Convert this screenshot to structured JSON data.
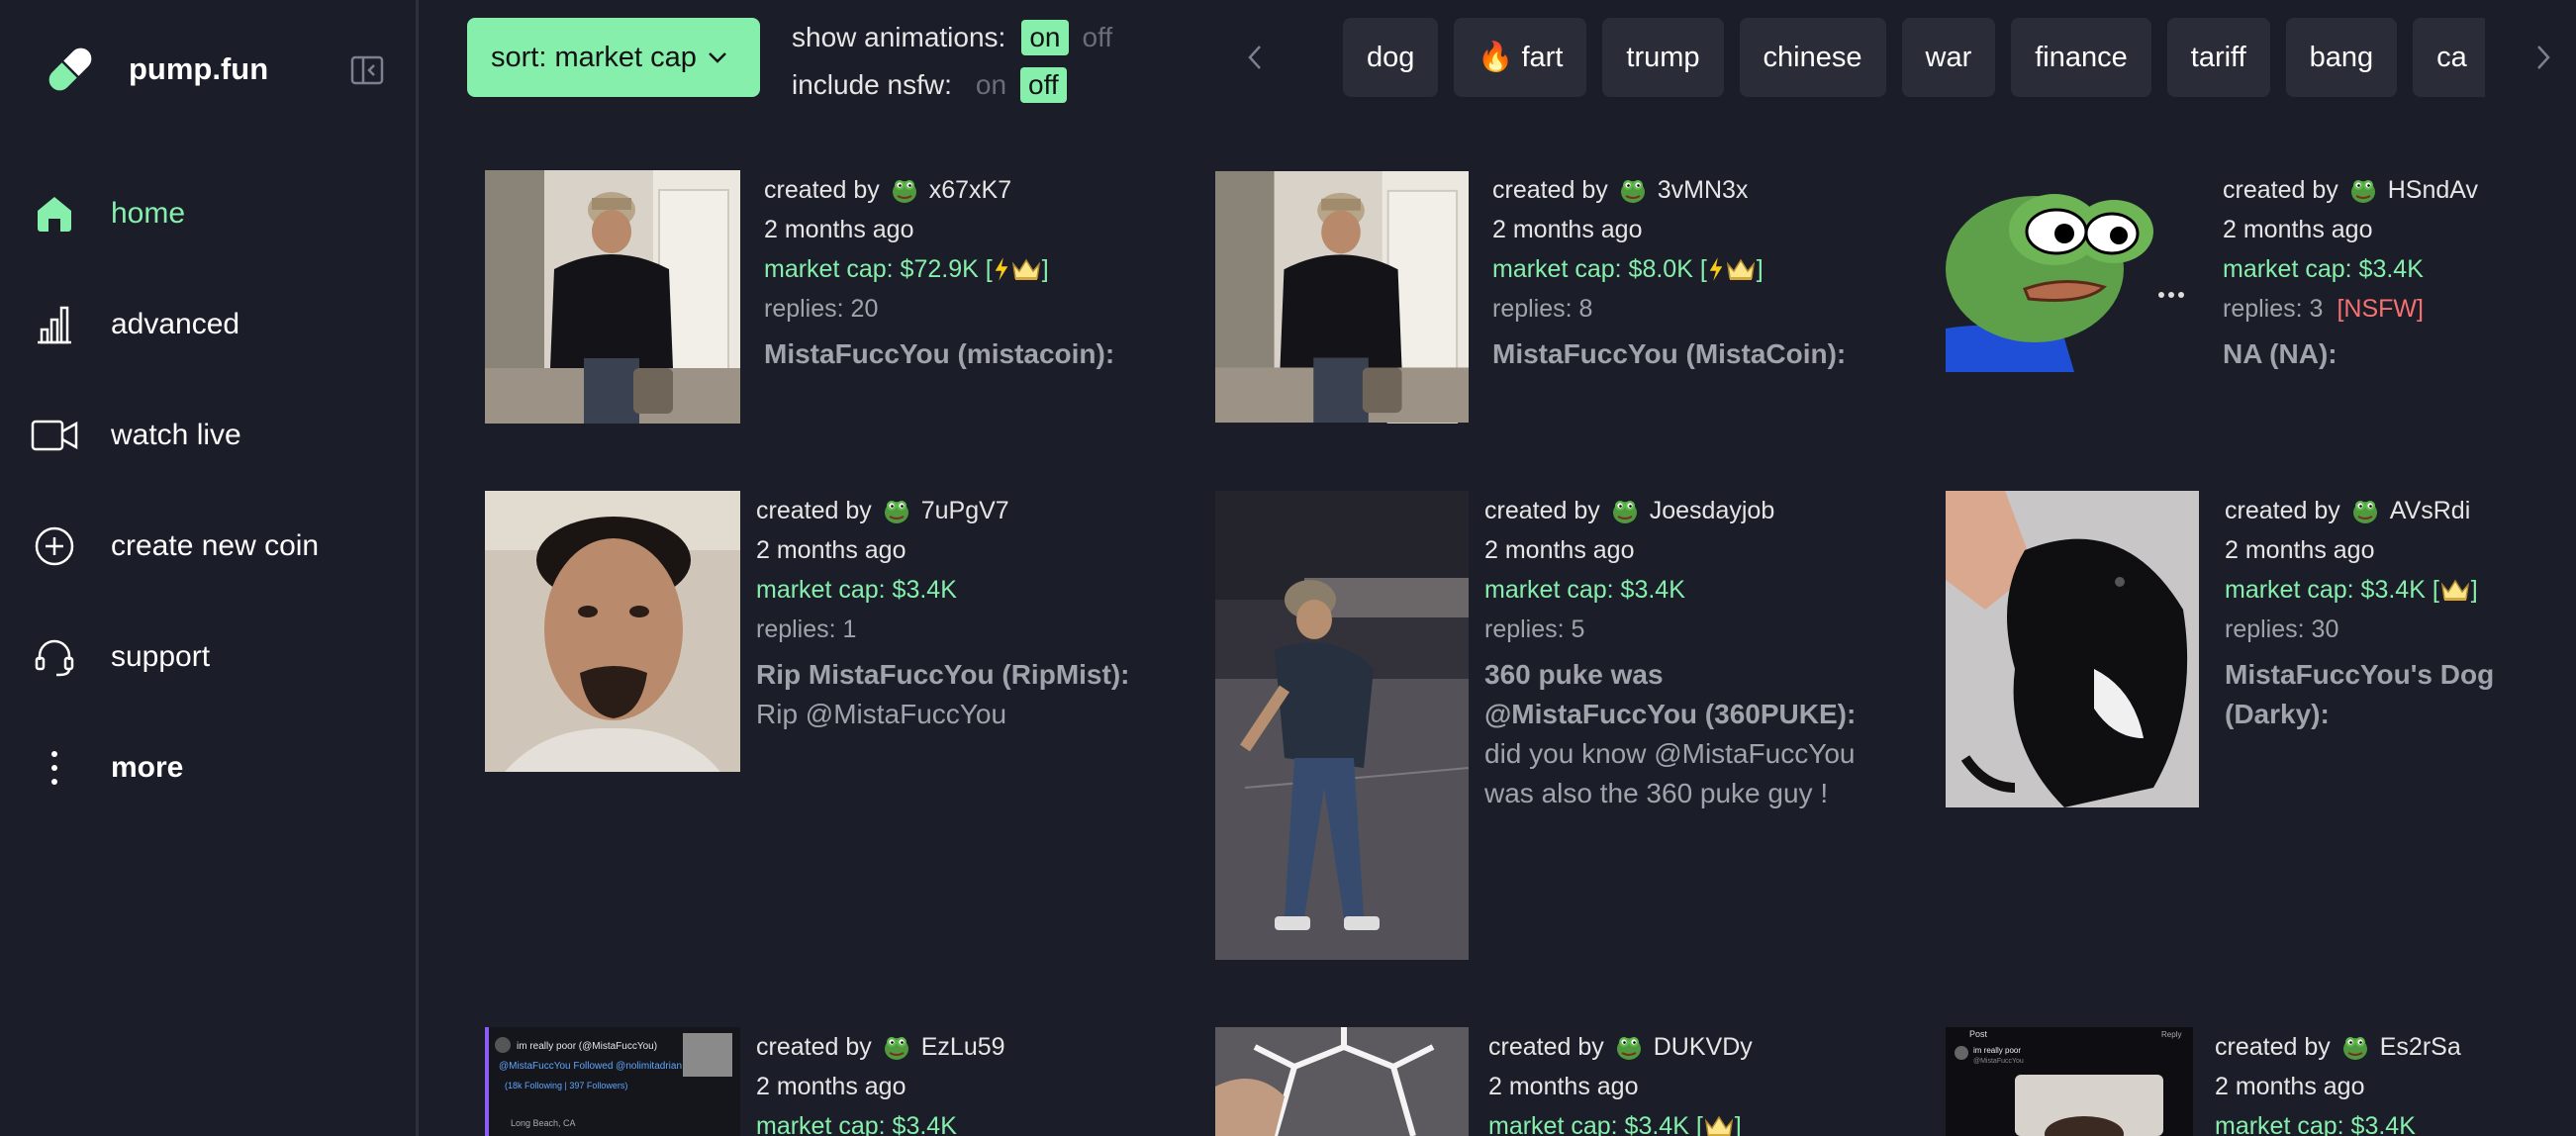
{
  "app": {
    "name": "pump.fun"
  },
  "sidebar": {
    "items": [
      {
        "label": "home",
        "icon": "home-icon",
        "active": true
      },
      {
        "label": "advanced",
        "icon": "bar-chart-icon"
      },
      {
        "label": "watch live",
        "icon": "video-camera-icon"
      },
      {
        "label": "create new coin",
        "icon": "plus-circle-icon"
      },
      {
        "label": "support",
        "icon": "headset-icon"
      },
      {
        "label": "more",
        "icon": "more-vertical-icon"
      }
    ]
  },
  "toolbar": {
    "sort_label": "sort: market cap",
    "animations_label": "show animations:",
    "nsfw_label": "include nsfw:",
    "on": "on",
    "off": "off",
    "animations_on": true,
    "nsfw_on": false
  },
  "chips": [
    "dog",
    "fart",
    "trump",
    "chinese",
    "war",
    "finance",
    "tariff",
    "bang",
    "ca"
  ],
  "cards": [
    {
      "creator": "x67xK7",
      "created_prefix": "created by",
      "age": "2 months ago",
      "mcap": "market cap: $72.9K",
      "badges": "bolt-crown",
      "replies": "replies: 20",
      "nsfw": "",
      "title": "MistaFuccYou (mistacoin):",
      "desc": ""
    },
    {
      "creator": "3vMN3x",
      "created_prefix": "created by",
      "age": "2 months ago",
      "mcap": "market cap: $8.0K",
      "badges": "bolt-crown",
      "replies": "replies: 8",
      "nsfw": "",
      "title": "MistaFuccYou (MistaCoin):",
      "desc": ""
    },
    {
      "creator": "HSndAv",
      "created_prefix": "created by",
      "age": "2 months ago",
      "mcap": "market cap: $3.4K",
      "badges": "",
      "replies": "replies: 3",
      "nsfw": "[NSFW]",
      "title": "NA (NA):",
      "desc": ""
    },
    {
      "creator": "7uPgV7",
      "created_prefix": "created by",
      "age": "2 months ago",
      "mcap": "market cap: $3.4K",
      "badges": "",
      "replies": "replies: 1",
      "nsfw": "",
      "title": "Rip MistaFuccYou (RipMist):",
      "desc": "Rip @MistaFuccYou"
    },
    {
      "creator": "Joesdayjob",
      "created_prefix": "created by",
      "age": "2 months ago",
      "mcap": "market cap: $3.4K",
      "badges": "",
      "replies": "replies: 5",
      "nsfw": "",
      "title_line1": "360 puke was",
      "title_line2": "@MistaFuccYou (360PUKE):",
      "desc_line1": "did you know @MistaFuccYou",
      "desc_line2": "was also the 360 puke guy !"
    },
    {
      "creator": "AVsRdi",
      "created_prefix": "created by",
      "age": "2 months ago",
      "mcap": "market cap: $3.4K",
      "badges": "crown",
      "replies": "replies: 30",
      "nsfw": "",
      "title_line1": "MistaFuccYou's Dog",
      "title_line2": "(Darky):"
    },
    {
      "creator": "EzLu59",
      "created_prefix": "created by",
      "age": "2 months ago",
      "mcap": "market cap: $3.4K",
      "badges": ""
    },
    {
      "creator": "DUKVDy",
      "created_prefix": "created by",
      "age": "2 months ago",
      "mcap": "market cap: $3.4K",
      "badges": "crown"
    },
    {
      "creator": "Es2rSa",
      "created_prefix": "created by",
      "age": "2 months ago",
      "mcap": "market cap: $3.4K",
      "badges": ""
    }
  ],
  "thumb_text": {
    "tweet_name": "im really poor (@MistaFuccYou)",
    "tweet_line": "@MistaFuccYou Followed @nolimitadrian",
    "tweet_follow": "(18k Following | 397 Followers)",
    "tweet_loc": "Long Beach, CA",
    "post_header": "Post",
    "post_reply": "Reply",
    "post_name": "im really poor",
    "post_handle": "@MistaFuccYou"
  },
  "colors": {
    "accent": "#86efac",
    "bg": "#1b1d28",
    "chip": "#2a2d38",
    "nsfw": "#f87171"
  }
}
